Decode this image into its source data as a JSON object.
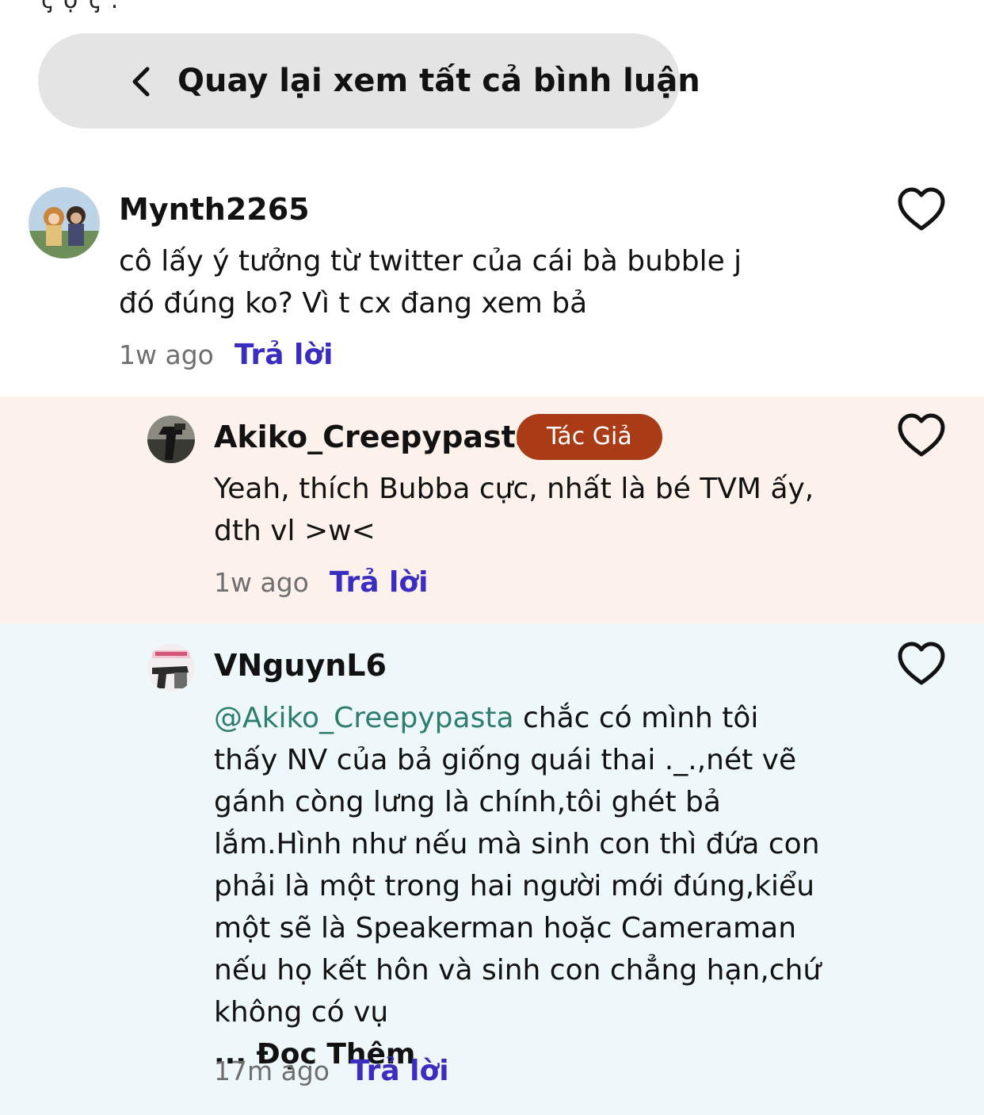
{
  "header": {
    "cut_text": "ꞔ ọ   ꞔ                  ."
  },
  "back_button": {
    "label": "Quay lại xem tất cả bình luận",
    "icon": "chevron-left-icon"
  },
  "comments": [
    {
      "username": "Mynth2265",
      "body": "cô lấy ý tưởng từ twitter của cái bà bubble j đó đúng ko? Vì t cx đang xem bả",
      "time": "1w ago",
      "reply_label": "Trả lời",
      "background": "#ffffff"
    },
    {
      "username": "Akiko_Creepypasta",
      "badge": "Tác Giả",
      "badge_color": "#a93b16",
      "body": "Yeah, thích Bubba cực, nhất là bé TVM ấy, dth vl >w<",
      "time": "1w ago",
      "reply_label": "Trả lời",
      "background": "#fdf1ec"
    },
    {
      "username": "VNguynL6",
      "mention": "@Akiko_Creepypasta",
      "body": " chắc có mình tôi thấy NV của bả giống quái thai ._.,nét vẽ gánh còng lưng là chính,tôi ghét bả lắm.Hình như nếu mà sinh con thì đứa con phải là một trong hai người mới đúng,kiểu một sẽ là Speakerman hoặc Cameraman nếu họ kết hôn và sinh con chẳng hạn,chứ không có vụ",
      "read_more": "... Đọc Thêm",
      "time": "17m ago",
      "reply_label": "Trả lời",
      "background": "#eef7f9"
    }
  ],
  "colors": {
    "accent_link": "#3a2dbf",
    "mention": "#2f7d6f",
    "meta_gray": "#6f6f6f"
  }
}
